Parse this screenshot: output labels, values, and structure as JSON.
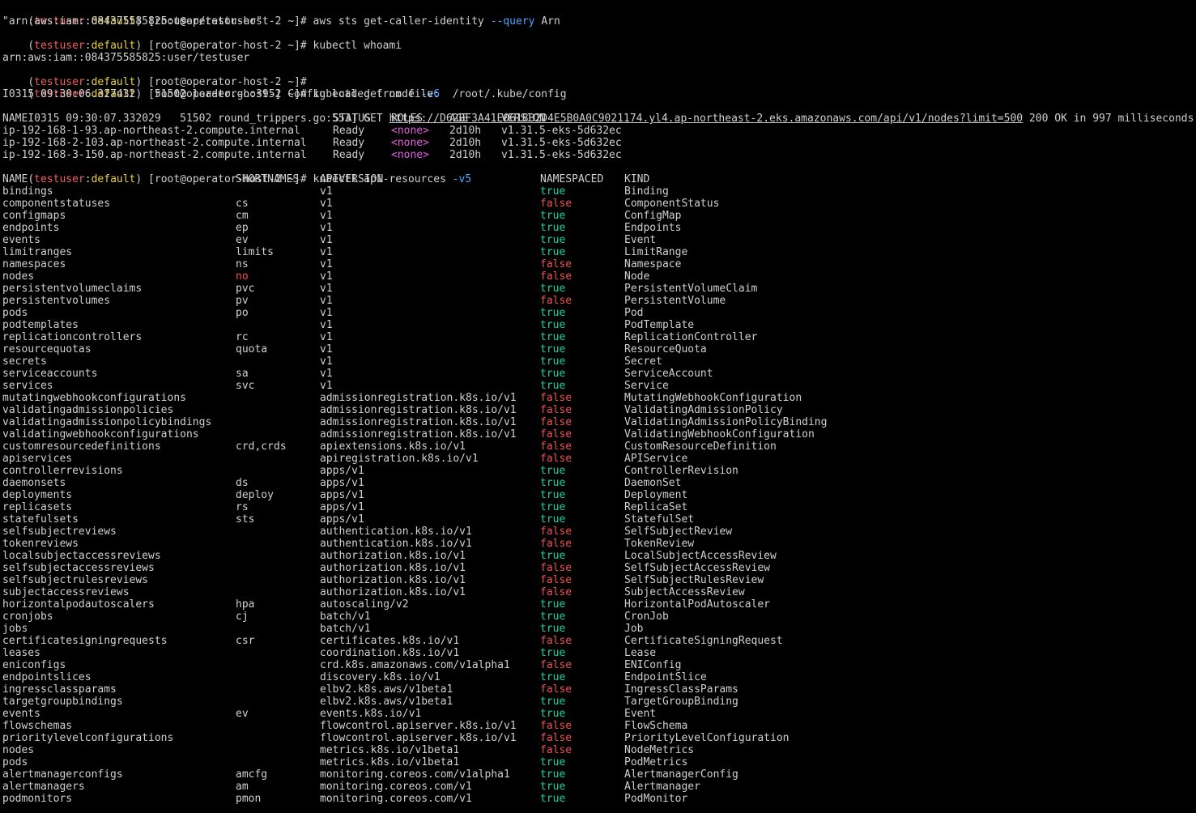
{
  "terminal": {
    "prompt": {
      "open": "(",
      "user": "testuser",
      "sep": ":",
      "ctx": "default",
      "close": ")",
      "host": " [root@operator-host-2 ~]# "
    },
    "cmd1": {
      "text": "aws sts get-caller-identity ",
      "opt": "--query",
      "rest": " Arn"
    },
    "out1": "\"arn:aws:iam::084375585825:user/testuser\"",
    "cmd2": "kubectl whoami",
    "out2": "arn:aws:iam::084375585825:user/testuser",
    "cmd3": {
      "text": "kubectl get node ",
      "opt": "-v6"
    },
    "log1": "I0315 09:30:06.327432   51502 loader.go:395] Config loaded from file:  /root/.kube/config",
    "log2": {
      "prefix": "I0315 09:30:07.332029   51502 round_trippers.go:553] GET ",
      "url": "https://D62BF3A41E0618B2D4E5B0A0C9021174.yl4.ap-northeast-2.eks.amazonaws.com/api/v1/nodes?limit=500",
      "suffix": " 200 OK in 997 milliseconds"
    },
    "nodes": {
      "headers": [
        "NAME",
        "STATUS",
        "ROLES",
        "AGE",
        "VERSION"
      ],
      "rows": [
        [
          "ip-192-168-1-93.ap-northeast-2.compute.internal",
          "Ready",
          "<none>",
          "2d10h",
          "v1.31.5-eks-5d632ec"
        ],
        [
          "ip-192-168-2-103.ap-northeast-2.compute.internal",
          "Ready",
          "<none>",
          "2d10h",
          "v1.31.5-eks-5d632ec"
        ],
        [
          "ip-192-168-3-150.ap-northeast-2.compute.internal",
          "Ready",
          "<none>",
          "2d10h",
          "v1.31.5-eks-5d632ec"
        ]
      ]
    },
    "cmd4": {
      "text": "kubectl api-resources ",
      "opt": "-v5"
    },
    "resources": {
      "headers": [
        "NAME",
        "SHORTNAMES",
        "APIVERSION",
        "NAMESPACED",
        "KIND"
      ],
      "rows": [
        [
          "bindings",
          "",
          "v1",
          "true",
          "Binding"
        ],
        [
          "componentstatuses",
          "cs",
          "v1",
          "false",
          "ComponentStatus"
        ],
        [
          "configmaps",
          "cm",
          "v1",
          "true",
          "ConfigMap"
        ],
        [
          "endpoints",
          "ep",
          "v1",
          "true",
          "Endpoints"
        ],
        [
          "events",
          "ev",
          "v1",
          "true",
          "Event"
        ],
        [
          "limitranges",
          "limits",
          "v1",
          "true",
          "LimitRange"
        ],
        [
          "namespaces",
          "ns",
          "v1",
          "false",
          "Namespace"
        ],
        [
          "nodes",
          "no",
          "v1",
          "false",
          "Node"
        ],
        [
          "persistentvolumeclaims",
          "pvc",
          "v1",
          "true",
          "PersistentVolumeClaim"
        ],
        [
          "persistentvolumes",
          "pv",
          "v1",
          "false",
          "PersistentVolume"
        ],
        [
          "pods",
          "po",
          "v1",
          "true",
          "Pod"
        ],
        [
          "podtemplates",
          "",
          "v1",
          "true",
          "PodTemplate"
        ],
        [
          "replicationcontrollers",
          "rc",
          "v1",
          "true",
          "ReplicationController"
        ],
        [
          "resourcequotas",
          "quota",
          "v1",
          "true",
          "ResourceQuota"
        ],
        [
          "secrets",
          "",
          "v1",
          "true",
          "Secret"
        ],
        [
          "serviceaccounts",
          "sa",
          "v1",
          "true",
          "ServiceAccount"
        ],
        [
          "services",
          "svc",
          "v1",
          "true",
          "Service"
        ],
        [
          "mutatingwebhookconfigurations",
          "",
          "admissionregistration.k8s.io/v1",
          "false",
          "MutatingWebhookConfiguration"
        ],
        [
          "validatingadmissionpolicies",
          "",
          "admissionregistration.k8s.io/v1",
          "false",
          "ValidatingAdmissionPolicy"
        ],
        [
          "validatingadmissionpolicybindings",
          "",
          "admissionregistration.k8s.io/v1",
          "false",
          "ValidatingAdmissionPolicyBinding"
        ],
        [
          "validatingwebhookconfigurations",
          "",
          "admissionregistration.k8s.io/v1",
          "false",
          "ValidatingWebhookConfiguration"
        ],
        [
          "customresourcedefinitions",
          "crd,crds",
          "apiextensions.k8s.io/v1",
          "false",
          "CustomResourceDefinition"
        ],
        [
          "apiservices",
          "",
          "apiregistration.k8s.io/v1",
          "false",
          "APIService"
        ],
        [
          "controllerrevisions",
          "",
          "apps/v1",
          "true",
          "ControllerRevision"
        ],
        [
          "daemonsets",
          "ds",
          "apps/v1",
          "true",
          "DaemonSet"
        ],
        [
          "deployments",
          "deploy",
          "apps/v1",
          "true",
          "Deployment"
        ],
        [
          "replicasets",
          "rs",
          "apps/v1",
          "true",
          "ReplicaSet"
        ],
        [
          "statefulsets",
          "sts",
          "apps/v1",
          "true",
          "StatefulSet"
        ],
        [
          "selfsubjectreviews",
          "",
          "authentication.k8s.io/v1",
          "false",
          "SelfSubjectReview"
        ],
        [
          "tokenreviews",
          "",
          "authentication.k8s.io/v1",
          "false",
          "TokenReview"
        ],
        [
          "localsubjectaccessreviews",
          "",
          "authorization.k8s.io/v1",
          "true",
          "LocalSubjectAccessReview"
        ],
        [
          "selfsubjectaccessreviews",
          "",
          "authorization.k8s.io/v1",
          "false",
          "SelfSubjectAccessReview"
        ],
        [
          "selfsubjectrulesreviews",
          "",
          "authorization.k8s.io/v1",
          "false",
          "SelfSubjectRulesReview"
        ],
        [
          "subjectaccessreviews",
          "",
          "authorization.k8s.io/v1",
          "false",
          "SubjectAccessReview"
        ],
        [
          "horizontalpodautoscalers",
          "hpa",
          "autoscaling/v2",
          "true",
          "HorizontalPodAutoscaler"
        ],
        [
          "cronjobs",
          "cj",
          "batch/v1",
          "true",
          "CronJob"
        ],
        [
          "jobs",
          "",
          "batch/v1",
          "true",
          "Job"
        ],
        [
          "certificatesigningrequests",
          "csr",
          "certificates.k8s.io/v1",
          "false",
          "CertificateSigningRequest"
        ],
        [
          "leases",
          "",
          "coordination.k8s.io/v1",
          "true",
          "Lease"
        ],
        [
          "eniconfigs",
          "",
          "crd.k8s.amazonaws.com/v1alpha1",
          "false",
          "ENIConfig"
        ],
        [
          "endpointslices",
          "",
          "discovery.k8s.io/v1",
          "true",
          "EndpointSlice"
        ],
        [
          "ingressclassparams",
          "",
          "elbv2.k8s.aws/v1beta1",
          "false",
          "IngressClassParams"
        ],
        [
          "targetgroupbindings",
          "",
          "elbv2.k8s.aws/v1beta1",
          "true",
          "TargetGroupBinding"
        ],
        [
          "events",
          "ev",
          "events.k8s.io/v1",
          "true",
          "Event"
        ],
        [
          "flowschemas",
          "",
          "flowcontrol.apiserver.k8s.io/v1",
          "false",
          "FlowSchema"
        ],
        [
          "prioritylevelconfigurations",
          "",
          "flowcontrol.apiserver.k8s.io/v1",
          "false",
          "PriorityLevelConfiguration"
        ],
        [
          "nodes",
          "",
          "metrics.k8s.io/v1beta1",
          "false",
          "NodeMetrics"
        ],
        [
          "pods",
          "",
          "metrics.k8s.io/v1beta1",
          "true",
          "PodMetrics"
        ],
        [
          "alertmanagerconfigs",
          "amcfg",
          "monitoring.coreos.com/v1alpha1",
          "true",
          "AlertmanagerConfig"
        ],
        [
          "alertmanagers",
          "am",
          "monitoring.coreos.com/v1",
          "true",
          "Alertmanager"
        ],
        [
          "podmonitors",
          "pmon",
          "monitoring.coreos.com/v1",
          "true",
          "PodMonitor"
        ]
      ]
    },
    "colors": {
      "background": "#000000",
      "foreground": "#d0d0d0",
      "prompt_user": "#f06060",
      "prompt_ctx": "#e8d040",
      "option": "#4fa6ff",
      "true_value": "#20d0a0",
      "false_value": "#f05050",
      "none_value": "#e060e0"
    }
  }
}
